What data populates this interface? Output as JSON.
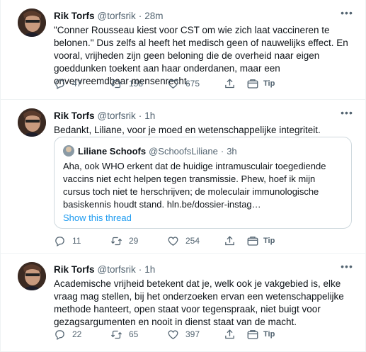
{
  "tweets": [
    {
      "name": "Rik Torfs",
      "handle": "@torfsrik",
      "dot": "·",
      "time": "28m",
      "text": "\"Conner Rousseau kiest voor CST om wie zich laat vaccineren te belonen.\" Dus zelfs al heeft het medisch geen of nauwelijks effect. En vooral, vrijheden zijn geen beloning die de overheid naar eigen goeddunken toekent aan haar onderdanen, maar een onvervreemdbaar mensenrecht.",
      "replies": "47",
      "retweets": "158",
      "likes": "675",
      "tip": "Tip"
    },
    {
      "name": "Rik Torfs",
      "handle": "@torfsrik",
      "dot": "·",
      "time": "1h",
      "text": "Bedankt, Liliane, voor je moed en wetenschappelijke integriteit.",
      "quote": {
        "name": "Liliane Schoofs",
        "handle": "@SchoofsLiliane",
        "dot": "·",
        "time": "3h",
        "text": "Aha, ook WHO erkent dat de huidige intramusculair toegediende vaccins niet echt helpen tegen transmissie. Phew, hoef ik mijn cursus toch niet te herschrijven; de moleculair immunologische basiskennis houdt stand.  hln.be/dossier-instag…",
        "show_thread": "Show this thread"
      },
      "replies": "11",
      "retweets": "29",
      "likes": "254",
      "tip": "Tip"
    },
    {
      "name": "Rik Torfs",
      "handle": "@torfsrik",
      "dot": "·",
      "time": "1h",
      "text": "Academische vrijheid betekent dat je, welk ook je vakgebied is, elke vraag mag stellen, bij het onderzoeken ervan een wetenschappelijke methode hanteert, open staat voor tegenspraak, niet buigt voor gezagsargumenten en nooit in dienst staat van de macht.",
      "replies": "22",
      "retweets": "65",
      "likes": "397",
      "tip": "Tip"
    }
  ],
  "colors": {
    "text": "#0f1419",
    "secondary": "#536471",
    "link": "#1d9bf0",
    "border": "#eff3f4",
    "quote_border": "#cfd9de"
  },
  "icons": {
    "more": "more-icon",
    "reply": "reply-icon",
    "retweet": "retweet-icon",
    "like": "like-icon",
    "share": "share-icon",
    "tip": "tip-icon"
  }
}
